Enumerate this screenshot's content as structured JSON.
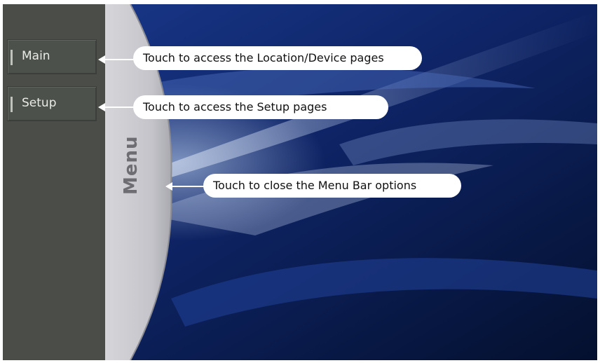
{
  "sidebar": {
    "items": [
      {
        "label": "Main"
      },
      {
        "label": "Setup"
      }
    ]
  },
  "menu_toggle": {
    "label": "Menu"
  },
  "callouts": {
    "main": "Touch to access the Location/Device pages",
    "setup": "Touch to access the Setup pages",
    "menu": "Touch to close the Menu Bar options"
  },
  "colors": {
    "sidebar_bg": "#4a4d48",
    "menu_curve": "#c9c9ce",
    "wallpaper_blue": "#0c1d52",
    "callout_bg": "#ffffff"
  },
  "icons": {
    "button_indicator": "vertical-bar-indicator",
    "callout_pointer": "arrow-left-icon"
  }
}
